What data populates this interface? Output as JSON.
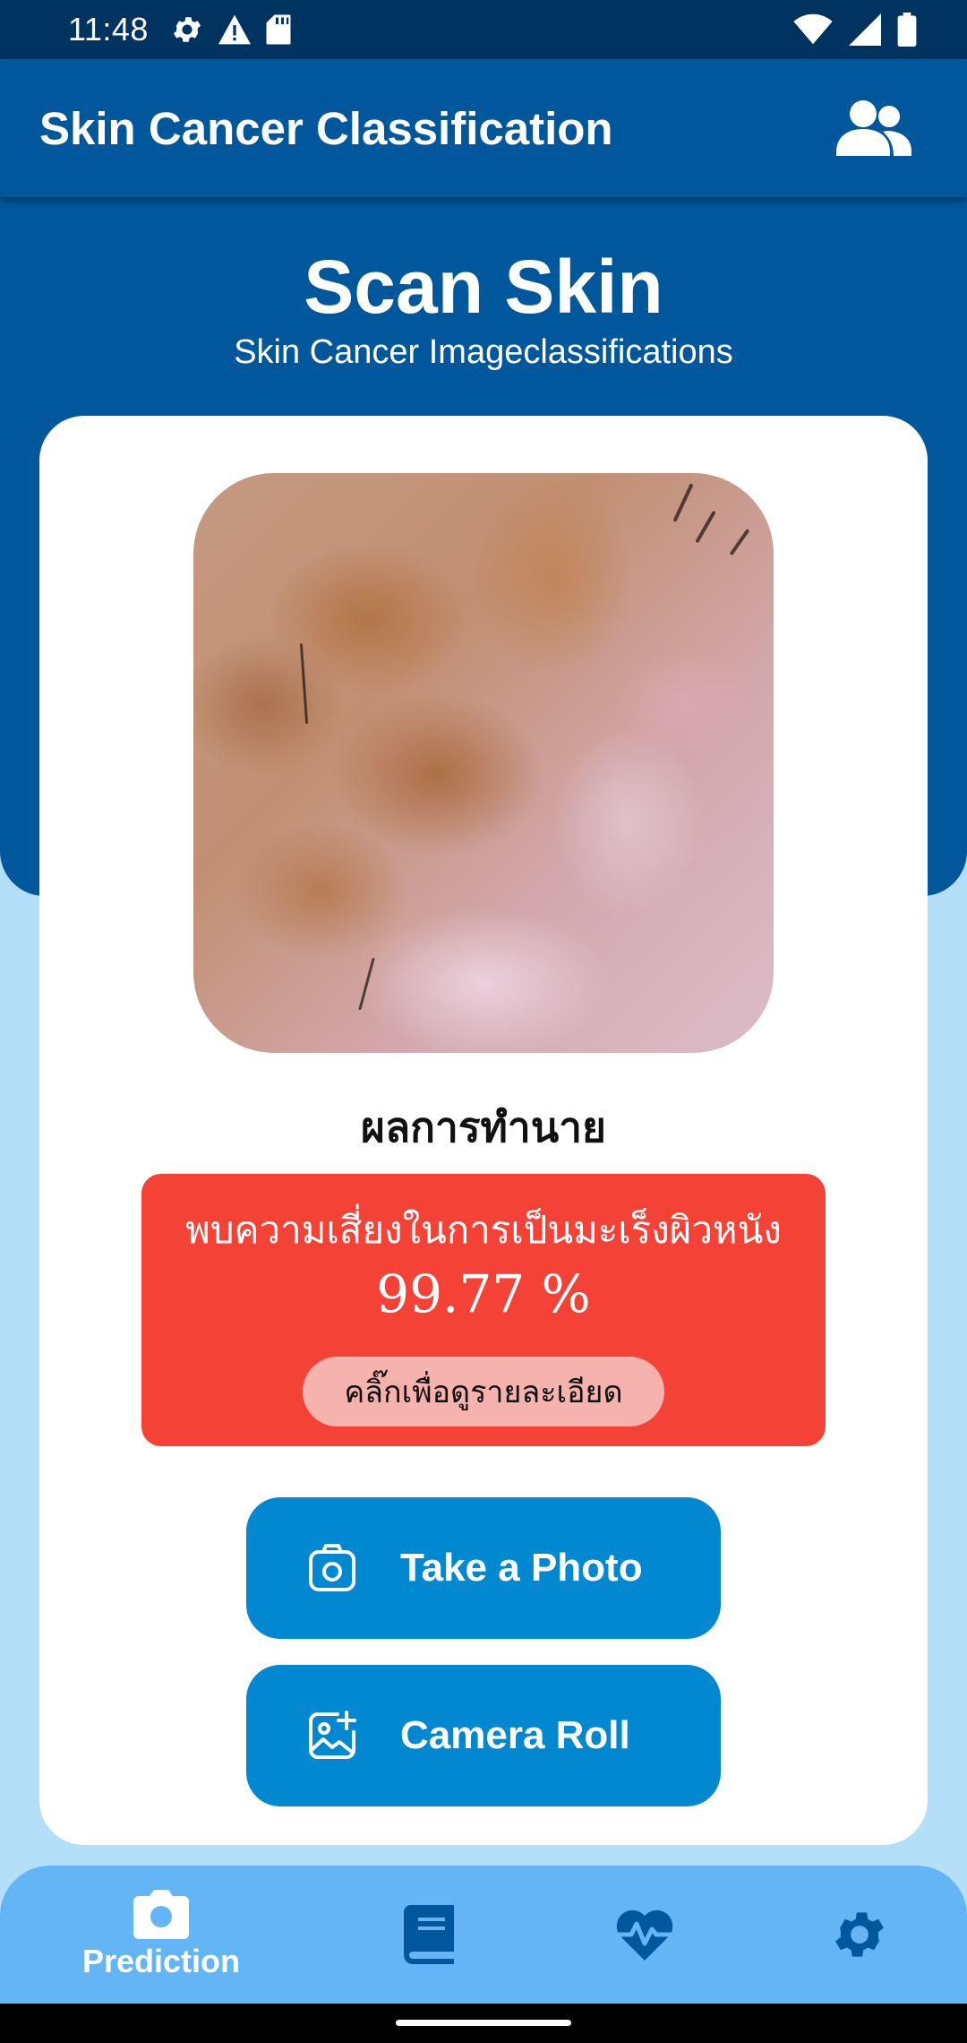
{
  "status_bar": {
    "time": "11:48",
    "left_icons": [
      "settings-gear-icon",
      "warning-icon",
      "sd-card-icon"
    ],
    "right_icons": [
      "wifi-icon",
      "cellular-signal-icon",
      "battery-icon"
    ]
  },
  "app_bar": {
    "title": "Skin Cancer Classification",
    "action_icon": "users-icon"
  },
  "hero": {
    "title": "Scan Skin",
    "subtitle": "Skin Cancer Imageclassifications"
  },
  "result": {
    "heading": "ผลการทำนาย",
    "message": "พบความเสี่ยงในการเป็นมะเร็งผิวหนัง",
    "confidence": "99.77 %",
    "detail_button": "คลิ๊กเพื่อดูรายละเอียด",
    "status_color": "#f44336"
  },
  "actions": {
    "take_photo": "Take a Photo",
    "camera_roll": "Camera Roll"
  },
  "bottom_nav": {
    "items": [
      {
        "label": "Prediction",
        "icon": "camera-icon",
        "active": true
      },
      {
        "label": "",
        "icon": "book-icon",
        "active": false
      },
      {
        "label": "",
        "icon": "heart-pulse-icon",
        "active": false
      },
      {
        "label": "",
        "icon": "settings-gear-icon",
        "active": false
      }
    ]
  },
  "colors": {
    "primary": "#01579b",
    "status_bar": "#00335f",
    "button": "#0288d1",
    "nav_bg": "#64b5f6",
    "page_bg": "#b3e0f8",
    "nav_inactive_icon": "#01579b"
  }
}
